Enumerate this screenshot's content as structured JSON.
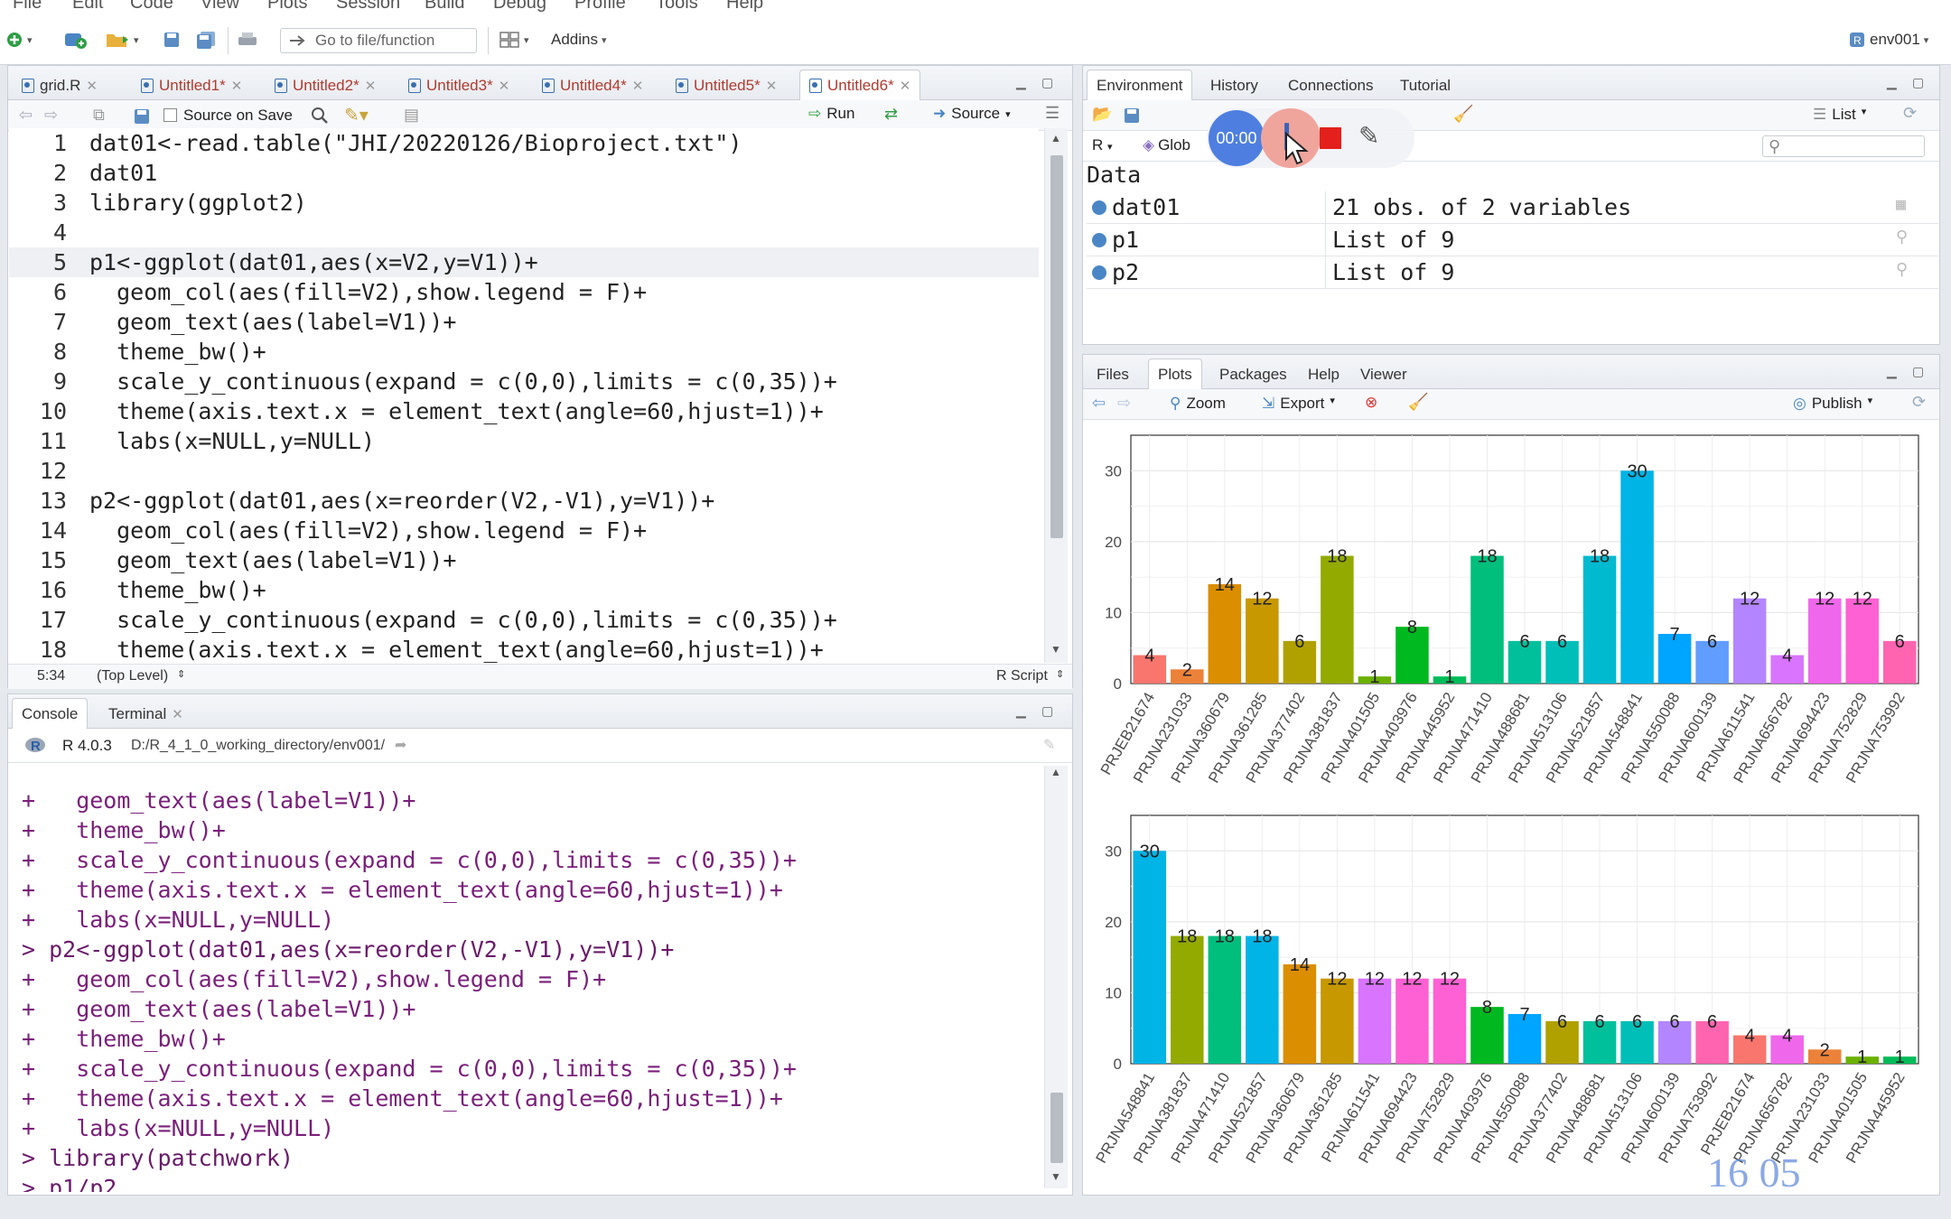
{
  "menubar": [
    "File",
    "Edit",
    "Code",
    "View",
    "Plots",
    "Session",
    "Build",
    "Debug",
    "Profile",
    "Tools",
    "Help"
  ],
  "toolbar": {
    "goto_placeholder": "Go to file/function",
    "addins": "Addins",
    "project": "env001"
  },
  "editor": {
    "tabs": [
      {
        "label": "grid.R",
        "modified": false,
        "active": false
      },
      {
        "label": "Untitled1*",
        "modified": true,
        "active": false
      },
      {
        "label": "Untitled2*",
        "modified": true,
        "active": false
      },
      {
        "label": "Untitled3*",
        "modified": true,
        "active": false
      },
      {
        "label": "Untitled4*",
        "modified": true,
        "active": false
      },
      {
        "label": "Untitled5*",
        "modified": true,
        "active": false
      },
      {
        "label": "Untitled6*",
        "modified": true,
        "active": true
      }
    ],
    "source_on_save": "Source on Save",
    "run": "Run",
    "source": "Source",
    "lines": [
      "dat01<-read.table(\"JHI/20220126/Bioproject.txt\")",
      "dat01",
      "library(ggplot2)",
      "",
      "p1<-ggplot(dat01,aes(x=V2,y=V1))+",
      "  geom_col(aes(fill=V2),show.legend = F)+",
      "  geom_text(aes(label=V1))+",
      "  theme_bw()+",
      "  scale_y_continuous(expand = c(0,0),limits = c(0,35))+",
      "  theme(axis.text.x = element_text(angle=60,hjust=1))+",
      "  labs(x=NULL,y=NULL)",
      "",
      "p2<-ggplot(dat01,aes(x=reorder(V2,-V1),y=V1))+",
      "  geom_col(aes(fill=V2),show.legend = F)+",
      "  geom_text(aes(label=V1))+",
      "  theme_bw()+",
      "  scale_y_continuous(expand = c(0,0),limits = c(0,35))+",
      "  theme(axis.text.x = element_text(angle=60,hjust=1))+"
    ],
    "current_line": 5,
    "status_pos": "5:34",
    "status_scope": "(Top Level)",
    "status_type": "R Script"
  },
  "console": {
    "tabs": [
      "Console",
      "Terminal"
    ],
    "version": "R 4.0.3",
    "path": "D:/R_4_1_0_working_directory/env001/",
    "lines": [
      "+   geom_text(aes(label=V1))+",
      "+   theme_bw()+",
      "+   scale_y_continuous(expand = c(0,0),limits = c(0,35))+",
      "+   theme(axis.text.x = element_text(angle=60,hjust=1))+",
      "+   labs(x=NULL,y=NULL)",
      "> p2<-ggplot(dat01,aes(x=reorder(V2,-V1),y=V1))+",
      "+   geom_col(aes(fill=V2),show.legend = F)+",
      "+   geom_text(aes(label=V1))+",
      "+   theme_bw()+",
      "+   scale_y_continuous(expand = c(0,0),limits = c(0,35))+",
      "+   theme(axis.text.x = element_text(angle=60,hjust=1))+",
      "+   labs(x=NULL,y=NULL)",
      "> library(patchwork)",
      "> p1/p2",
      "> "
    ]
  },
  "environment": {
    "tabs": [
      "Environment",
      "History",
      "Connections",
      "Tutorial"
    ],
    "list_mode": "List",
    "lang": "R",
    "scope": "Glob",
    "section": "Data",
    "rows": [
      {
        "name": "dat01",
        "value": "21 obs. of 2 variables"
      },
      {
        "name": "p1",
        "value": "List of  9"
      },
      {
        "name": "p2",
        "value": "List of  9"
      }
    ]
  },
  "recorder": {
    "time": "00:00"
  },
  "files": {
    "tabs": [
      "Files",
      "Plots",
      "Packages",
      "Help",
      "Viewer"
    ],
    "zoom": "Zoom",
    "export": "Export",
    "publish": "Publish"
  },
  "watermark": "16  05",
  "chart_data": [
    {
      "type": "bar",
      "categories": [
        "PRJEB21674",
        "PRJNA231033",
        "PRJNA360679",
        "PRJNA361285",
        "PRJNA377402",
        "PRJNA381837",
        "PRJNA401505",
        "PRJNA403976",
        "PRJNA445952",
        "PRJNA471410",
        "PRJNA488681",
        "PRJNA513106",
        "PRJNA521857",
        "PRJNA548841",
        "PRJNA550088",
        "PRJNA600139",
        "PRJNA611541",
        "PRJNA656782",
        "PRJNA694423",
        "PRJNA752829",
        "PRJNA753992"
      ],
      "values": [
        4,
        2,
        14,
        12,
        6,
        18,
        1,
        8,
        1,
        18,
        6,
        6,
        18,
        30,
        7,
        6,
        12,
        4,
        12,
        12,
        6
      ],
      "colors": [
        "#f8766d",
        "#ec8239",
        "#db8e00",
        "#c79800",
        "#b0a100",
        "#93aa00",
        "#6bb100",
        "#00b81f",
        "#00bc59",
        "#00bf7d",
        "#00c09c",
        "#00bfb8",
        "#00bad0",
        "#00b4e6",
        "#00a5ff",
        "#619cff",
        "#b386ff",
        "#d874fd",
        "#ef67eb",
        "#fd61d3",
        "#ff64b0"
      ],
      "yticks": [
        0,
        10,
        20,
        30
      ],
      "ylim": [
        0,
        35
      ],
      "xlabel": "",
      "ylabel": ""
    },
    {
      "type": "bar",
      "categories": [
        "PRJNA548841",
        "PRJNA381837",
        "PRJNA471410",
        "PRJNA521857",
        "PRJNA360679",
        "PRJNA361285",
        "PRJNA611541",
        "PRJNA694423",
        "PRJNA752829",
        "PRJNA403976",
        "PRJNA550088",
        "PRJNA377402",
        "PRJNA488681",
        "PRJNA513106",
        "PRJNA600139",
        "PRJNA753992",
        "PRJEB21674",
        "PRJNA656782",
        "PRJNA231033",
        "PRJNA401505",
        "PRJNA445952"
      ],
      "values": [
        30,
        18,
        18,
        18,
        14,
        12,
        12,
        12,
        12,
        8,
        7,
        6,
        6,
        6,
        6,
        6,
        4,
        4,
        2,
        1,
        1
      ],
      "colors": [
        "#00b4e6",
        "#93aa00",
        "#00bf7d",
        "#00b4e6",
        "#db8e00",
        "#c79800",
        "#d874fd",
        "#fd61d3",
        "#fd61d3",
        "#00b81f",
        "#00a5ff",
        "#b0a100",
        "#00c09c",
        "#00bfb8",
        "#b386ff",
        "#ff64b0",
        "#f8766d",
        "#ef67eb",
        "#ec8239",
        "#6bb100",
        "#00bc59"
      ],
      "yticks": [
        0,
        10,
        20,
        30
      ],
      "ylim": [
        0,
        35
      ],
      "xlabel": "",
      "ylabel": ""
    }
  ]
}
